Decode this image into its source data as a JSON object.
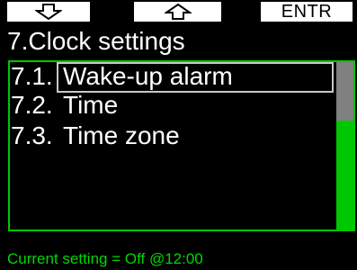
{
  "softkeys": {
    "left_icon": "down-arrow-icon",
    "middle_icon": "up-arrow-icon",
    "right_label": "ENTR"
  },
  "title": "7.Clock settings",
  "menu": {
    "items": [
      {
        "number": "7.1.",
        "label": "Wake-up alarm",
        "selected": true
      },
      {
        "number": "7.2.",
        "label": "Time",
        "selected": false
      },
      {
        "number": "7.3.",
        "label": "Time zone",
        "selected": false
      }
    ]
  },
  "status": {
    "text": "Current setting = Off @12:00"
  },
  "colors": {
    "background": "#000000",
    "accent_green": "#00c800",
    "text": "#ffffff",
    "selection_border": "#c8c8c8",
    "scroll_thumb": "#808080"
  }
}
